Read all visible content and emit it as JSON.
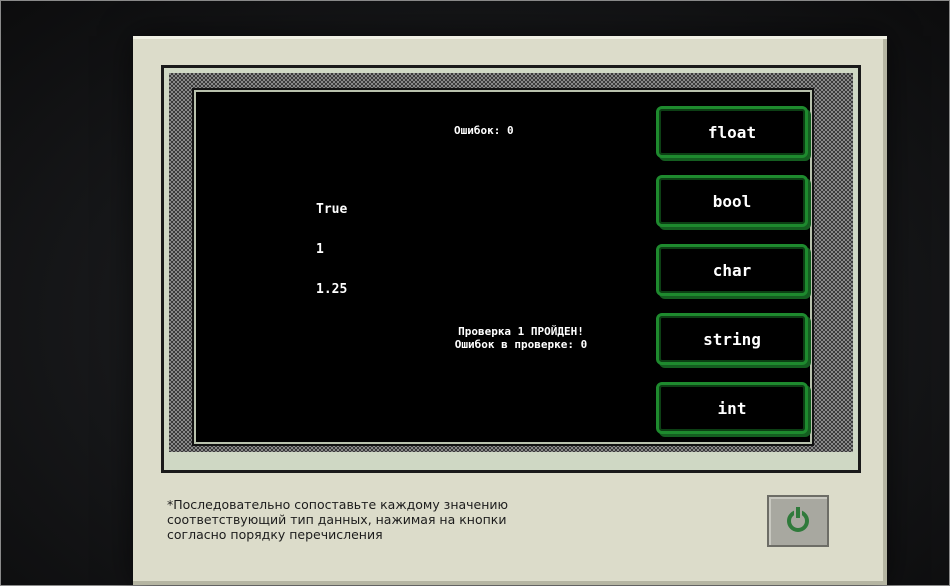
{
  "screen": {
    "errors_label": "Ошибок: 0",
    "values": [
      "True",
      "1",
      "1.25"
    ],
    "status_line1": "Проверка 1 ПРОЙДЕН!",
    "status_line2": "Ошибок в проверке: 0"
  },
  "buttons": [
    {
      "label": "float"
    },
    {
      "label": "bool"
    },
    {
      "label": "char"
    },
    {
      "label": "string"
    },
    {
      "label": "int"
    }
  ],
  "instructions": {
    "line1": "*Последовательно сопоставьте каждому значению",
    "line2": "соответствующий тип данных, нажимая на кнопки",
    "line3": "согласно порядку перечисления"
  },
  "power_button": {
    "icon": "power-icon",
    "color": "#2f7a3b"
  },
  "colors": {
    "button_border": "#1e8a2e",
    "screen_bg": "#000000",
    "monitor_bg": "#dcdcca"
  }
}
